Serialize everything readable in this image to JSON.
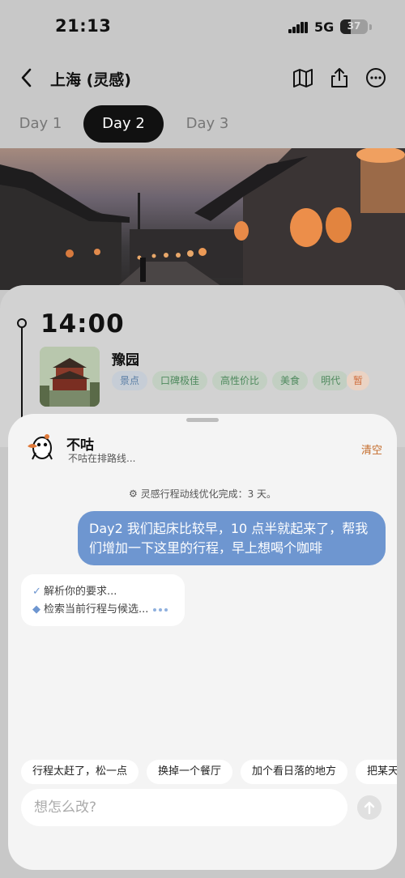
{
  "status_bar": {
    "time": "21:13",
    "network": "5G",
    "battery": "37",
    "battery_level": 0.37
  },
  "header": {
    "title": "上海 (灵感)",
    "icons": [
      "back-icon",
      "map-icon",
      "share-icon",
      "more-icon"
    ]
  },
  "days": [
    {
      "label": "Day 1",
      "active": false
    },
    {
      "label": "Day 2",
      "active": true
    },
    {
      "label": "Day 3",
      "active": false
    }
  ],
  "timeline": {
    "time": "14:00",
    "poi": {
      "name": "豫园",
      "tags": [
        "景点",
        "口碑极佳",
        "高性价比",
        "美食",
        "明代"
      ],
      "pause_tag": "暂"
    }
  },
  "assistant": {
    "name": "不咕",
    "status": "不咕在排路线...",
    "clear": "清空",
    "system_message": "灵感行程动线优化完成：3 天。",
    "user_message": "Day2 我们起床比较早，10 点半就起来了，帮我们增加一下这里的行程，早上想喝个咖啡",
    "progress": [
      "解析你的要求...",
      "检索当前行程与候选..."
    ],
    "suggestions": [
      "行程太赶了，松一点",
      "换掉一个餐厅",
      "加个看日落的地方",
      "把某天"
    ],
    "input_placeholder": "想怎么改?"
  },
  "colors": {
    "accent_blue": "#6e96d0",
    "clear_orange": "#c46b2a",
    "tag_green": "#4f8a5e",
    "tag_blue": "#5a7ea5"
  }
}
